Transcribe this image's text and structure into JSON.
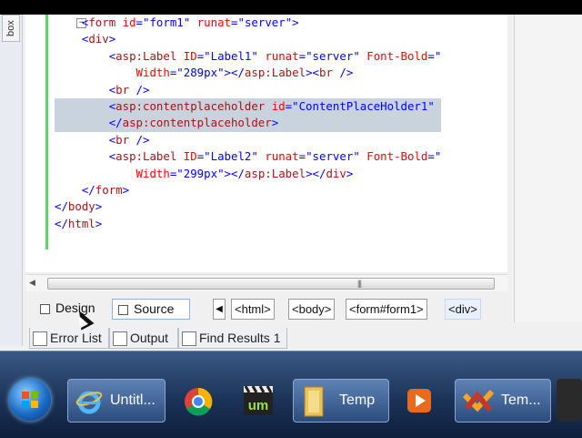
{
  "editor": {
    "toolbox_label": "box",
    "code_lines": [
      {
        "html": "    <span class=\"br\">&lt;</span><span class=\"t\">form</span> <span class=\"a\">id</span><span class=\"br\">=\"</span><span class=\"v\">form1</span><span class=\"br\">\"</span> <span class=\"a\">runat</span><span class=\"br\">=\"</span><span class=\"v\">server</span><span class=\"br\">\"&gt;</span>",
        "hl": false
      },
      {
        "html": "    <span class=\"br\">&lt;</span><span class=\"t\">div</span><span class=\"br\">&gt;</span>",
        "hl": false
      },
      {
        "html": "        <span class=\"br\">&lt;</span><span class=\"t\">asp:Label</span> <span class=\"a\">ID</span><span class=\"br\">=\"</span><span class=\"v\">Label1</span><span class=\"br\">\"</span> <span class=\"a\">runat</span><span class=\"br\">=\"</span><span class=\"v\">server</span><span class=\"br\">\"</span> <span class=\"a\">Font-Bold</span><span class=\"br\">=\"</span>",
        "hl": false
      },
      {
        "html": "            <span class=\"a\">Width</span><span class=\"br\">=\"</span><span class=\"v\">289px</span><span class=\"br\">\"&gt;&lt;/</span><span class=\"t\">asp:Label</span><span class=\"br\">&gt;&lt;</span><span class=\"t\">br</span> <span class=\"br\">/&gt;</span>",
        "hl": false
      },
      {
        "html": "        <span class=\"br\">&lt;</span><span class=\"t\">br</span> <span class=\"br\">/&gt;</span>",
        "hl": false
      },
      {
        "html": "        <span class=\"br\">&lt;</span><span class=\"t\">asp:contentplaceholder</span> <span class=\"a\">id</span><span class=\"br\">=\"</span><span class=\"v\">ContentPlaceHolder1</span><span class=\"br\">\"</span> ",
        "hl": true
      },
      {
        "html": "        <span class=\"br\">&lt;/</span><span class=\"t\">asp:contentplaceholder</span><span class=\"br\">&gt;</span>",
        "hl": true
      },
      {
        "html": "        <span class=\"br\">&lt;</span><span class=\"t\">br</span> <span class=\"br\">/&gt;</span>",
        "hl": false
      },
      {
        "html": "        <span class=\"br\">&lt;</span><span class=\"t\">asp:Label</span> <span class=\"a\">ID</span><span class=\"br\">=\"</span><span class=\"v\">Label2</span><span class=\"br\">\"</span> <span class=\"a\">runat</span><span class=\"br\">=\"</span><span class=\"v\">server</span><span class=\"br\">\"</span> <span class=\"a\">Font-Bold</span><span class=\"br\">=\"</span>",
        "hl": false
      },
      {
        "html": "            <span class=\"a\">Width</span><span class=\"br\">=\"</span><span class=\"v\">299px</span><span class=\"br\">\"&gt;&lt;/</span><span class=\"t\">asp:Label</span><span class=\"br\">&gt;&lt;/</span><span class=\"t\">div</span><span class=\"br\">&gt;</span>",
        "hl": false
      },
      {
        "html": "    <span class=\"br\">&lt;/</span><span class=\"t\">form</span><span class=\"br\">&gt;</span>",
        "hl": false
      },
      {
        "html": "<span class=\"br\">&lt;/</span><span class=\"t\">body</span><span class=\"br\">&gt;</span>",
        "hl": false
      },
      {
        "html": "<span class=\"br\">&lt;/</span><span class=\"t\">html</span><span class=\"br\">&gt;</span>",
        "hl": false
      }
    ]
  },
  "view_tabs": {
    "design": "Design",
    "source": "Source"
  },
  "tag_navigator": [
    "<html>",
    "<body>",
    "<form#form1>",
    "<div>"
  ],
  "tool_windows": [
    "Error List",
    "Output",
    "Find Results 1"
  ],
  "taskbar": {
    "items": [
      {
        "label": "Untitl...",
        "icon": "internet-explorer-icon"
      },
      {
        "label": "",
        "icon": "chrome-icon"
      },
      {
        "label": "",
        "icon": "um-app-icon"
      },
      {
        "label": "Temp",
        "icon": "folder-icon"
      },
      {
        "label": "",
        "icon": "media-player-icon"
      },
      {
        "label": "Tem...",
        "icon": "visual-studio-icon"
      }
    ]
  }
}
